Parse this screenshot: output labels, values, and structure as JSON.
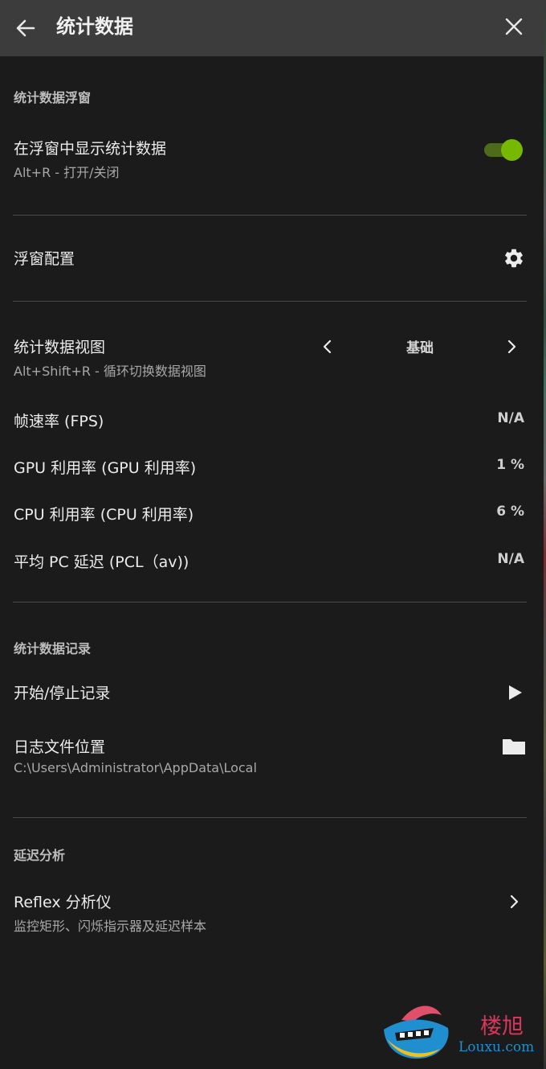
{
  "header": {
    "title": "统计数据",
    "back_icon": "arrow-left-icon",
    "close_icon": "close-icon"
  },
  "overlay_section": {
    "label": "统计数据浮窗",
    "show_stats": {
      "label": "在浮窗中显示统计数据",
      "hotkey": "Alt+R - 打开/关闭",
      "enabled": true
    },
    "config": {
      "label": "浮窗配置",
      "icon": "gear-icon"
    }
  },
  "view_section": {
    "label": "统计数据视图",
    "hotkey": "Alt+Shift+R - 循环切换数据视图",
    "current": "基础",
    "metrics": [
      {
        "name": "帧速率 (FPS)",
        "value": "N/A"
      },
      {
        "name": "GPU 利用率 (GPU 利用率)",
        "value": "1 %"
      },
      {
        "name": "CPU 利用率 (CPU 利用率)",
        "value": "6 %"
      },
      {
        "name": "平均 PC 延迟 (PCL（av))",
        "value": "N/A"
      }
    ]
  },
  "log_section": {
    "label": "统计数据记录",
    "record": {
      "label": "开始/停止记录",
      "icon": "play-icon"
    },
    "location": {
      "label": "日志文件位置",
      "path": "C:\\Users\\Administrator\\AppData\\Local",
      "icon": "folder-icon"
    }
  },
  "latency_section": {
    "label": "延迟分析",
    "reflex": {
      "label": "Reflex 分析仪",
      "desc": "监控矩形、闪烁指示器及延迟样本"
    }
  },
  "watermark": {
    "cn": "楼旭",
    "en": "Louxu.com"
  },
  "colors": {
    "accent": "#76b900",
    "header_bg": "#3c3c3c",
    "bg": "#1b1b1b"
  }
}
